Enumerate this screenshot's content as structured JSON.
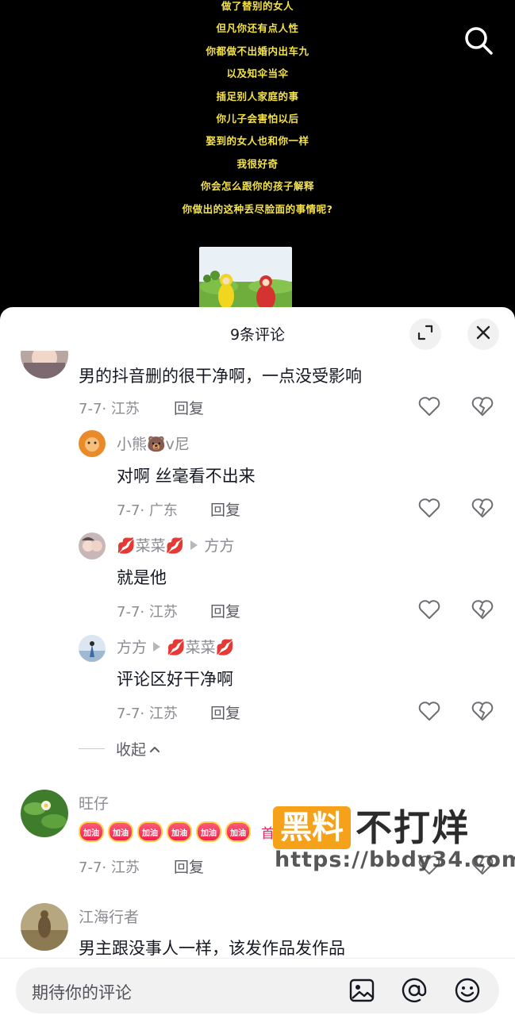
{
  "video": {
    "subtitles": [
      "做了替别的女人",
      "但凡你还有点人性",
      "你都做不出婚内出车九",
      "以及知伞当伞",
      "插足别人家庭的事",
      "你儿子会害怕以后",
      "娶到的女人也和你一样",
      "我很好奇",
      "你会怎么跟你的孩子解释",
      "你做出的这种丢尽脸面的事情呢?"
    ],
    "search_icon": "search-icon"
  },
  "sheet": {
    "title": "9条评论"
  },
  "comments": [
    {
      "text": "男的抖音删的很干净啊，一点没受影响",
      "meta": "7-7· 江苏",
      "reply": "回复"
    },
    {
      "user": "小熊🐻v尼",
      "text": "对啊 丝毫看不出来",
      "meta": "7-7· 广东",
      "reply": "回复"
    },
    {
      "user": "💋菜菜💋",
      "to": "方方",
      "text": "就是他",
      "meta": "7-7· 江苏",
      "reply": "回复"
    },
    {
      "user": "方方",
      "to": "💋菜菜💋",
      "text": "评论区好干净啊",
      "meta": "7-7· 江苏",
      "reply": "回复"
    },
    {
      "user": "旺仔",
      "cheer_label": "加油",
      "cheer_tail": "首",
      "meta": "7-7· 江苏",
      "reply": "回复"
    },
    {
      "user": "江海行者",
      "text": "男主跟没事人一样，该发作品发作品"
    }
  ],
  "collapse": {
    "label": "收起"
  },
  "watermark": {
    "badge": "黑料",
    "text": "不打烊",
    "url": "https://bbdy34.com"
  },
  "input": {
    "placeholder": "期待你的评论"
  },
  "colors": {
    "subtitle": "#f3e24a",
    "watermark_badge": "#f5a11a",
    "cheer": "#f0234d"
  }
}
